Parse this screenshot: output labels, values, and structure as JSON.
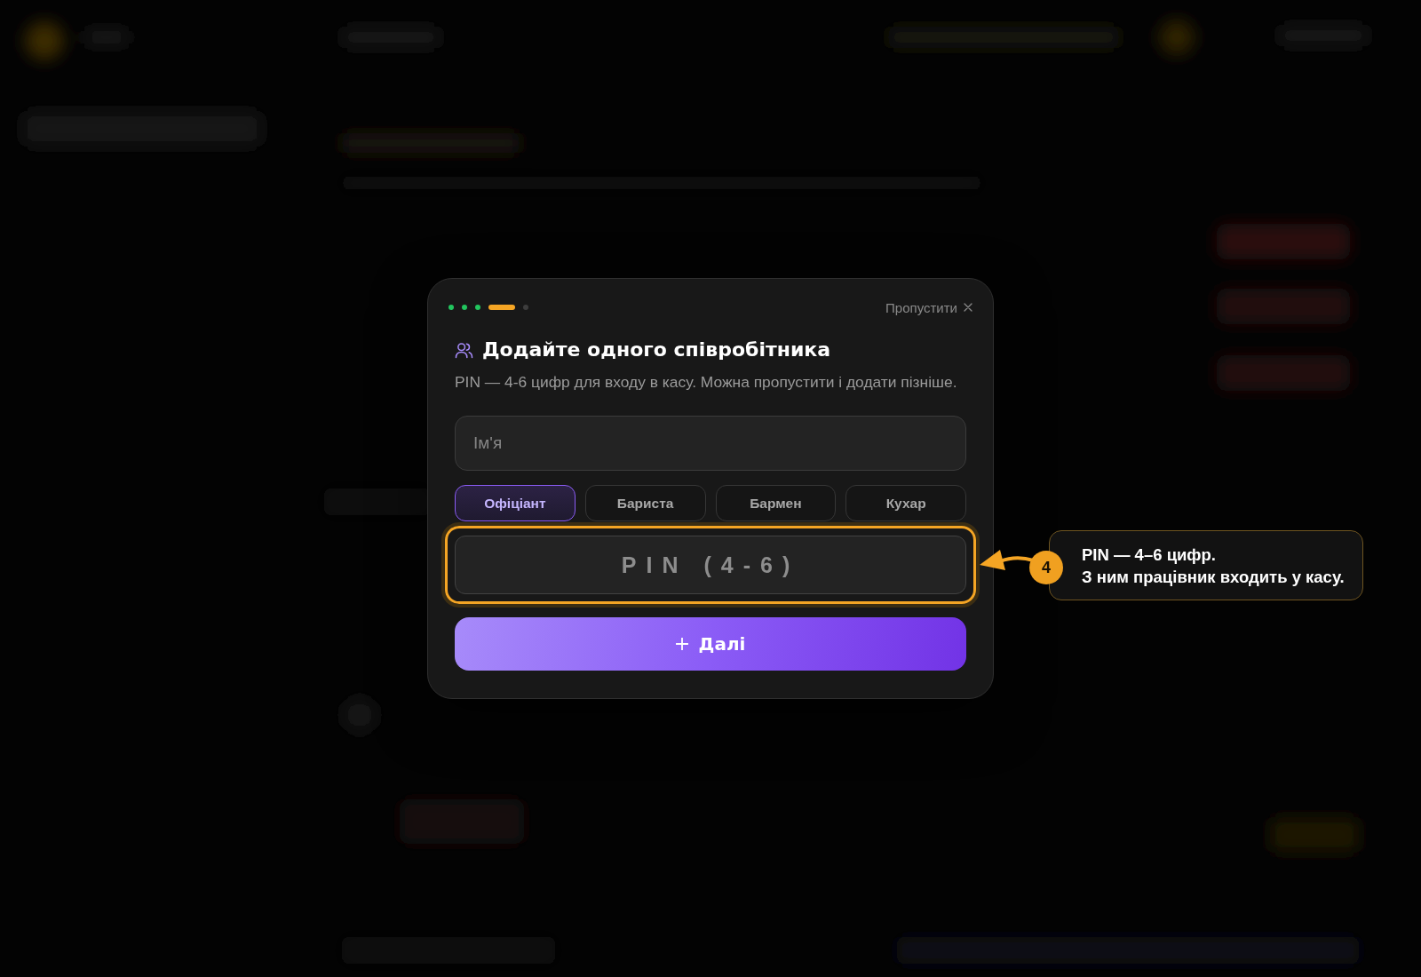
{
  "progress": {
    "steps": [
      {
        "done": true,
        "current": false
      },
      {
        "done": true,
        "current": false
      },
      {
        "done": true,
        "current": false
      },
      {
        "done": false,
        "current": true
      },
      {
        "done": false,
        "current": false
      }
    ]
  },
  "skip_button": {
    "label": "Пропустити"
  },
  "title": "Додайте одного співробітника",
  "subtitle": "PIN — 4-6 цифр для входу в касу. Можна пропустити і додати пізніше.",
  "name_field": {
    "placeholder": "Ім'я"
  },
  "roles": [
    {
      "label": "Офіціант",
      "selected": true
    },
    {
      "label": "Бариста",
      "selected": false
    },
    {
      "label": "Бармен",
      "selected": false
    },
    {
      "label": "Кухар",
      "selected": false
    }
  ],
  "pin_field": {
    "placeholder": "PIN (4-6)",
    "highlighted": true
  },
  "next_button": {
    "label": "Далі"
  },
  "tour_callout": {
    "step": "4",
    "lines": [
      "PIN — 4–6 цифр.",
      "З ним працівник входить у касу."
    ]
  }
}
